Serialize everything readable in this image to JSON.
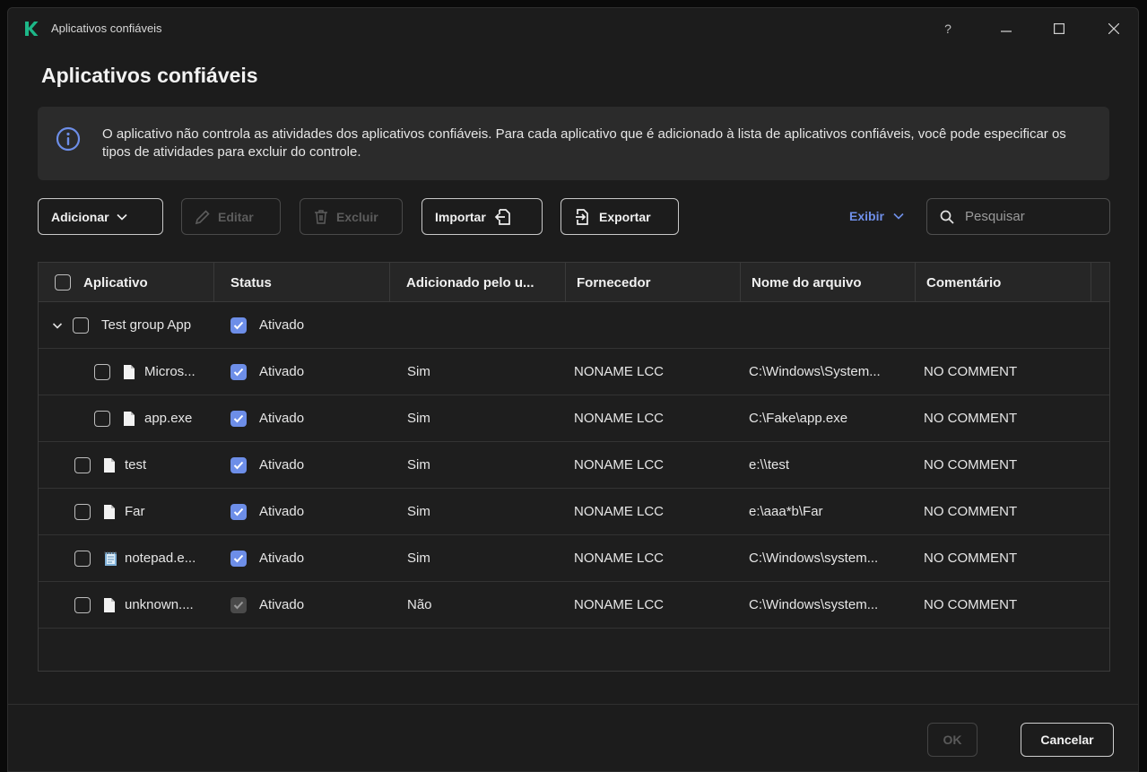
{
  "window": {
    "title": "Aplicativos confiáveis",
    "help": "?"
  },
  "page": {
    "title": "Aplicativos confiáveis"
  },
  "info": {
    "text": "O aplicativo não controla as atividades dos aplicativos confiáveis. Para cada aplicativo que é adicionado à lista de aplicativos confiáveis, você pode especificar os tipos de atividades para excluir do controle."
  },
  "toolbar": {
    "add": "Adicionar",
    "edit": "Editar",
    "delete": "Excluir",
    "import": "Importar",
    "export": "Exportar",
    "view": "Exibir",
    "search_placeholder": "Pesquisar"
  },
  "table": {
    "columns": [
      "Aplicativo",
      "Status",
      "Adicionado pelo u...",
      "Fornecedor",
      "Nome do arquivo",
      "Comentário"
    ],
    "group": {
      "name": "Test group App",
      "status": "Ativado"
    },
    "rows": [
      {
        "name": "Micros...",
        "status": "Ativado",
        "added": "Sim",
        "vendor": "NONAME LCC",
        "file": "C:\\Windows\\System...",
        "comment": "NO COMMENT",
        "icon": "file-icon"
      },
      {
        "name": "app.exe",
        "status": "Ativado",
        "added": "Sim",
        "vendor": "NONAME LCC",
        "file": "C:\\Fake\\app.exe",
        "comment": "NO COMMENT",
        "icon": "file-icon"
      },
      {
        "name": "test",
        "status": "Ativado",
        "added": "Sim",
        "vendor": "NONAME LCC",
        "file": "e:\\\\test",
        "comment": "NO COMMENT",
        "icon": "file-icon"
      },
      {
        "name": "Far",
        "status": "Ativado",
        "added": "Sim",
        "vendor": "NONAME LCC",
        "file": "e:\\aaa*b\\Far",
        "comment": "NO COMMENT",
        "icon": "file-icon"
      },
      {
        "name": "notepad.e...",
        "status": "Ativado",
        "added": "Sim",
        "vendor": "NONAME LCC",
        "file": "C:\\Windows\\system...",
        "comment": "NO COMMENT",
        "icon": "notepad-icon"
      },
      {
        "name": "unknown....",
        "status": "Ativado",
        "added": "Não",
        "vendor": "NONAME LCC",
        "file": "C:\\Windows\\system...",
        "comment": "NO COMMENT",
        "icon": "file-icon"
      }
    ]
  },
  "footer": {
    "ok": "OK",
    "cancel": "Cancelar"
  },
  "colors": {
    "accent": "#6d8ee8",
    "background": "#1c1c1c",
    "logo": "#1db788"
  }
}
